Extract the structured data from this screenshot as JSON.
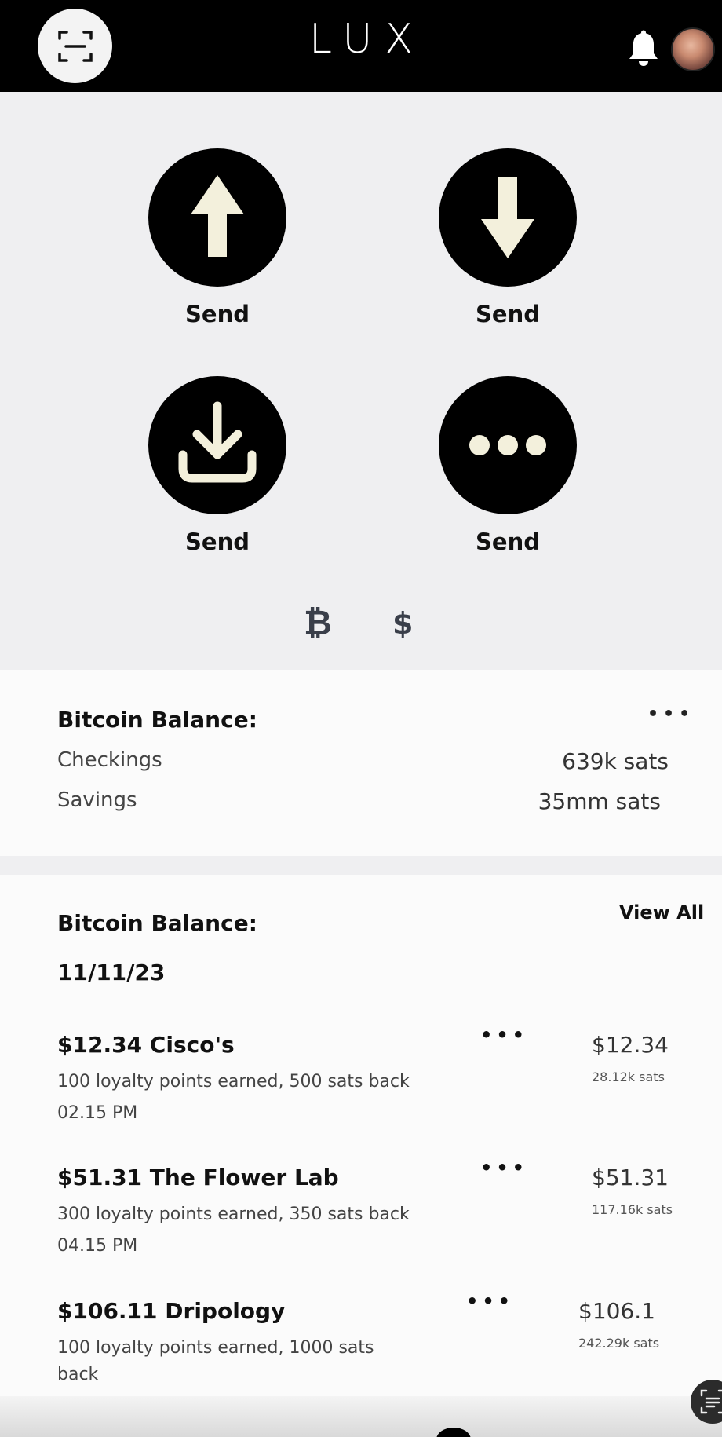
{
  "header": {
    "logo": "LUX",
    "scan_icon": "scan-icon",
    "bell_icon": "bell-icon"
  },
  "actions": [
    {
      "label": "Send",
      "icon": "arrow-up-icon"
    },
    {
      "label": "Send",
      "icon": "arrow-down-icon"
    },
    {
      "label": "Send",
      "icon": "download-tray-icon"
    },
    {
      "label": "Send",
      "icon": "more-dots-icon"
    }
  ],
  "currency_toggle": {
    "bitcoin": "₿",
    "dollar": "$"
  },
  "balance_card": {
    "title": "Bitcoin Balance:",
    "menu": "•••",
    "rows": [
      {
        "label": "Checkings",
        "value": "639k sats"
      },
      {
        "label": "Savings",
        "value": "35mm sats"
      }
    ]
  },
  "transactions": {
    "title": "Bitcoin Balance:",
    "view_all": "View All",
    "date": "11/11/23",
    "items": [
      {
        "title": "$12.34 Cisco's",
        "desc": "100 loyalty points earned, 500 sats back",
        "time": "02.15 PM",
        "menu": "•••",
        "amount": "$12.34",
        "sats": "28.12k sats"
      },
      {
        "title": "$51.31  The Flower Lab",
        "desc": "300 loyalty points earned, 350 sats back",
        "time": "04.15 PM",
        "menu": "•••",
        "amount": "$51.31",
        "sats": "117.16k sats"
      },
      {
        "title": "$106.11  Dripology",
        "desc": "100 loyalty points earned, 1000 sats back",
        "time": "",
        "menu": "•••",
        "amount": "$106.1",
        "sats": "242.29k sats"
      }
    ]
  },
  "colors": {
    "header_bg": "#000000",
    "page_bg": "#efeff1",
    "card_bg": "#fbfbfb",
    "icon_fill": "#f3f0dc"
  }
}
